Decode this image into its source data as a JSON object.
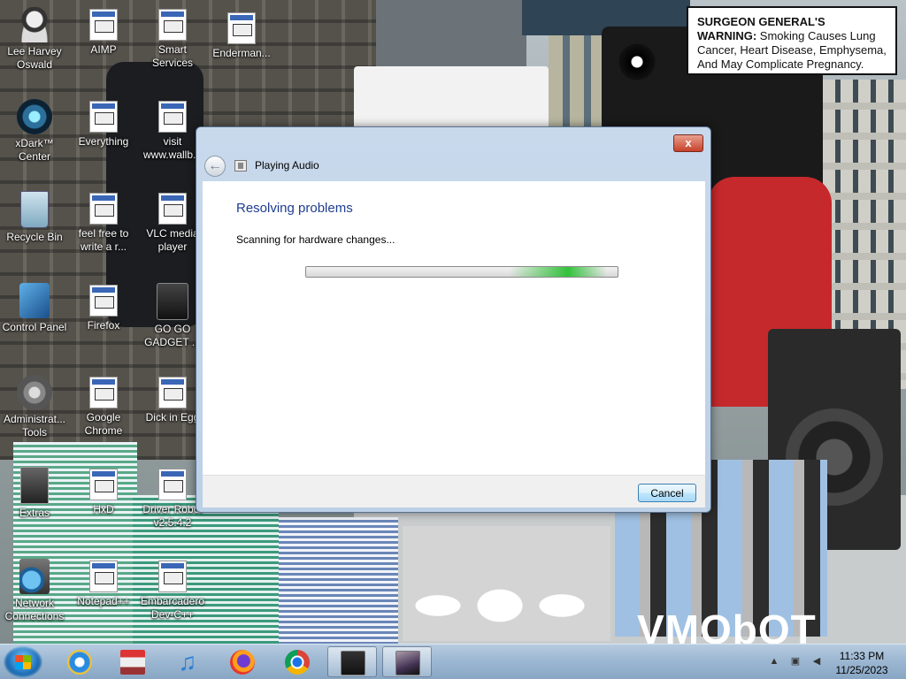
{
  "desktop": {
    "icons": [
      {
        "label": "Lee Harvey Oswald",
        "icon": "person-icon"
      },
      {
        "label": "AIMP",
        "icon": "aimp-icon"
      },
      {
        "label": "Smart Services",
        "icon": "gear-icon"
      },
      {
        "label": "Enderman...",
        "icon": "app-window-icon"
      },
      {
        "label": "xDark™ Center",
        "icon": "xdark-icon"
      },
      {
        "label": "Everything",
        "icon": "search-icon"
      },
      {
        "label": "visit www.wallb...",
        "icon": "document-icon"
      },
      {
        "label": "Recycle Bin",
        "icon": "recycle-bin-icon"
      },
      {
        "label": "feel free to write a r...",
        "icon": "document-icon"
      },
      {
        "label": "VLC media player",
        "icon": "vlc-icon"
      },
      {
        "label": "Control Panel",
        "icon": "control-panel-icon"
      },
      {
        "label": "Firefox",
        "icon": "firefox-icon"
      },
      {
        "label": "GO GO GADGET ...",
        "icon": "gadget-icon"
      },
      {
        "label": "Administrat... Tools",
        "icon": "admin-tools-icon"
      },
      {
        "label": "Google Chrome",
        "icon": "chrome-icon"
      },
      {
        "label": "Dick in Egg",
        "icon": "app-icon"
      },
      {
        "label": "Extras",
        "icon": "folder-icon"
      },
      {
        "label": "HxD",
        "icon": "hxd-icon"
      },
      {
        "label": "Driver Robot v2.5.4.2",
        "icon": "shield-icon"
      },
      {
        "label": "Network Connections",
        "icon": "network-icon"
      },
      {
        "label": "Notepad++",
        "icon": "notepad-icon"
      },
      {
        "label": "Embarcadero Dev-C++",
        "icon": "devcpp-icon"
      }
    ],
    "warning": {
      "bold": "SURGEON GENERAL'S WARNING:",
      "text": " Smoking Causes Lung Cancer, Heart Disease, Emphysema, And May Complicate Pregnancy."
    },
    "watermark": "VMObOT"
  },
  "dialog": {
    "title": "Playing Audio",
    "heading": "Resolving problems",
    "status": "Scanning for hardware changes...",
    "progress_indeterminate": true,
    "close_label": "x",
    "back_label": "←",
    "cancel_label": "Cancel"
  },
  "taskbar": {
    "pinned": [
      {
        "name": "internet-explorer",
        "icon": "ie-icon"
      },
      {
        "name": "media-app",
        "icon": "media-center-icon"
      },
      {
        "name": "itunes",
        "icon": "music-note-icon"
      },
      {
        "name": "firefox",
        "icon": "firefox-icon"
      },
      {
        "name": "chrome",
        "icon": "chrome-icon"
      },
      {
        "name": "desktop-app",
        "icon": "monitor-icon"
      },
      {
        "name": "wallpaper-app",
        "icon": "image-icon"
      }
    ],
    "clock_time": "11:33 PM",
    "clock_date": "11/25/2023"
  },
  "colors": {
    "dialog_heading": "#1e3d8f",
    "progress_green": "#34c13c",
    "taskbar": "#9bb6d1"
  }
}
